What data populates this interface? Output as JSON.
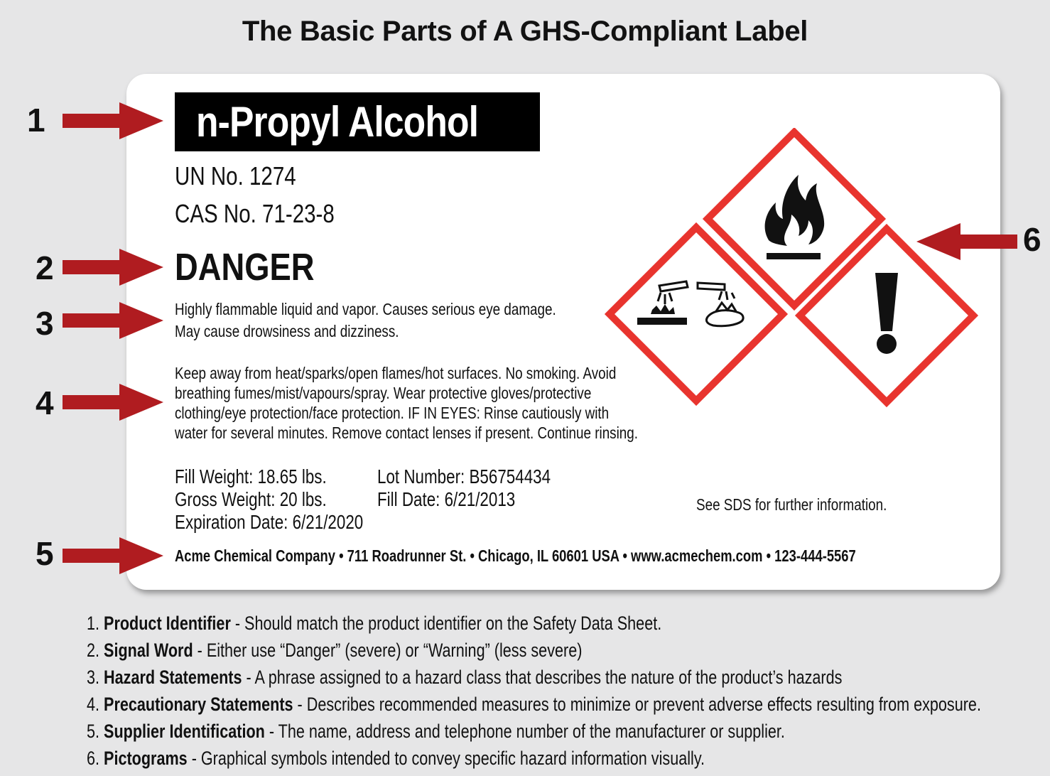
{
  "title": "The Basic Parts of A GHS-Compliant Label",
  "label": {
    "product_identifier": "n-Propyl Alcohol",
    "un_no": "UN No. 1274",
    "cas_no": "CAS No.  71-23-8",
    "signal_word": "DANGER",
    "hazard_statements": [
      "Highly flammable liquid and vapor. Causes serious eye damage.",
      "May cause drowsiness and dizziness."
    ],
    "precautionary_statements": [
      "Keep away from heat/sparks/open flames/hot surfaces. No smoking. Avoid",
      "breathing fumes/mist/vapours/spray. Wear protective gloves/protective",
      "clothing/eye protection/face protection. IF IN EYES: Rinse cautiously with",
      "water for several minutes. Remove contact lenses if present. Continue rinsing."
    ],
    "fill_weight": "Fill Weight: 18.65 lbs.",
    "gross_weight": "Gross Weight: 20 lbs.",
    "expiration_date": "Expiration Date: 6/21/2020",
    "lot_number": "Lot Number: B56754434",
    "fill_date": "Fill Date: 6/21/2013",
    "sds_note": "See SDS for further information.",
    "supplier": "Acme Chemical Company • 711 Roadrunner St. • Chicago, IL 60601  USA • www.acmechem.com • 123-444-5567",
    "pictograms": [
      "flame-icon",
      "corrosion-icon",
      "exclamation-mark-icon"
    ]
  },
  "callouts": [
    "1",
    "2",
    "3",
    "4",
    "5",
    "6"
  ],
  "legend": [
    {
      "index": "1.",
      "term": "Product Identifier",
      "description": " - Should match the product identifier on the Safety Data Sheet."
    },
    {
      "index": "2.",
      "term": "Signal Word",
      "description": " - Either use “Danger” (severe) or “Warning” (less severe)"
    },
    {
      "index": "3.",
      "term": "Hazard Statements",
      "description": " -  A phrase assigned to a hazard class that describes the nature of the product’s hazards"
    },
    {
      "index": "4.",
      "term": "Precautionary Statements",
      "description": " - Describes recommended measures to minimize or prevent adverse effects resulting from exposure."
    },
    {
      "index": "5.",
      "term": "Supplier Identification",
      "description": " - The name, address and telephone number of the manufacturer or supplier."
    },
    {
      "index": "6.",
      "term": "Pictograms",
      "description": " - Graphical symbols intended to convey specific hazard information visually."
    }
  ],
  "colors": {
    "arrow": "#b01c20",
    "pictogram_border": "#e8342e",
    "background": "#e6e6e7"
  }
}
